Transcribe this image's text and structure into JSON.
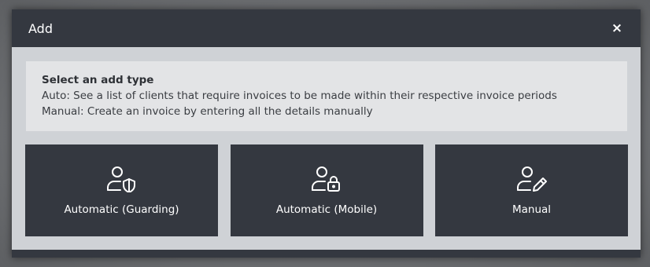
{
  "modal": {
    "title": "Add",
    "close_label": "×"
  },
  "info": {
    "heading": "Select an add type",
    "line1": "Auto: See a list of clients that require invoices to be made within their respective invoice periods",
    "line2": "Manual: Create an invoice by entering all the details manually"
  },
  "options": [
    {
      "label": "Automatic (Guarding)",
      "icon": "user-shield-icon"
    },
    {
      "label": "Automatic (Mobile)",
      "icon": "user-lock-icon"
    },
    {
      "label": "Manual",
      "icon": "user-pen-icon"
    }
  ],
  "colors": {
    "header_bg": "#343840",
    "modal_bg": "#cfd2d6",
    "panel_bg": "#e3e4e6",
    "card_bg": "#343840",
    "text_light": "#ffffff"
  }
}
